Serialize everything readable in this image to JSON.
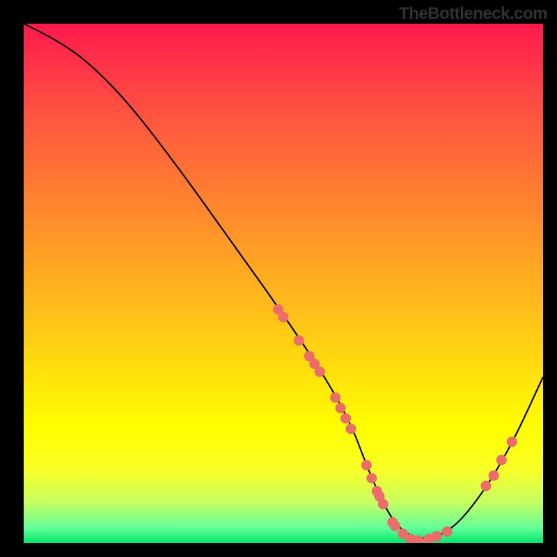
{
  "watermark": "TheBottleneck.com",
  "chart_data": {
    "type": "line",
    "title": "",
    "xlabel": "",
    "ylabel": "",
    "xlim": [
      0,
      100
    ],
    "ylim": [
      0,
      100
    ],
    "curve": {
      "x": [
        0,
        6,
        12,
        20,
        30,
        40,
        50,
        58,
        63,
        66,
        69,
        72,
        76,
        82,
        88,
        94,
        100
      ],
      "y": [
        100,
        97,
        93,
        85,
        72,
        58,
        44,
        32,
        23,
        15,
        8,
        3,
        0.5,
        2,
        9,
        19,
        32
      ]
    },
    "scatter_points": [
      {
        "x": 49,
        "y": 45
      },
      {
        "x": 50,
        "y": 43.5
      },
      {
        "x": 53,
        "y": 39
      },
      {
        "x": 55,
        "y": 36
      },
      {
        "x": 56,
        "y": 34.5
      },
      {
        "x": 57,
        "y": 33
      },
      {
        "x": 60,
        "y": 28
      },
      {
        "x": 61,
        "y": 26
      },
      {
        "x": 62,
        "y": 24
      },
      {
        "x": 63,
        "y": 22
      },
      {
        "x": 66,
        "y": 15
      },
      {
        "x": 67,
        "y": 12.5
      },
      {
        "x": 68,
        "y": 10
      },
      {
        "x": 68.5,
        "y": 9
      },
      {
        "x": 69.2,
        "y": 7.5
      },
      {
        "x": 71,
        "y": 4
      },
      {
        "x": 71.5,
        "y": 3.3
      },
      {
        "x": 73,
        "y": 1.8
      },
      {
        "x": 74.5,
        "y": 0.8
      },
      {
        "x": 76,
        "y": 0.5
      },
      {
        "x": 78,
        "y": 0.8
      },
      {
        "x": 79.5,
        "y": 1.3
      },
      {
        "x": 81.5,
        "y": 2.2
      },
      {
        "x": 89,
        "y": 11
      },
      {
        "x": 90.5,
        "y": 13
      },
      {
        "x": 92,
        "y": 16
      },
      {
        "x": 94,
        "y": 19.5
      }
    ],
    "colors": {
      "curve_stroke": "#000000",
      "point_fill": "#ec6b6b",
      "point_stroke": "#d94f4f"
    }
  }
}
